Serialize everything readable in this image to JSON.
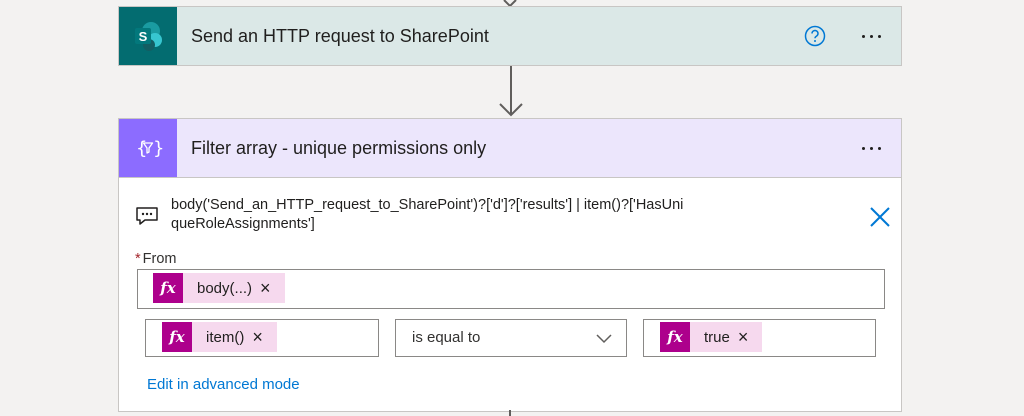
{
  "sharepoint_action": {
    "title": "Send an HTTP request to SharePoint",
    "icon": "sharepoint-logo-icon",
    "icon_letter": "S",
    "help_icon": "question-circle-icon",
    "more_icon": "more-dots-icon",
    "accent": "#036c70",
    "header_bg": "#dbe8e7"
  },
  "filter_action": {
    "title": "Filter array - unique permissions only",
    "icon": "filter-braces-icon",
    "icon_text": "{",
    "icon_text_right": "}",
    "more_icon": "more-dots-icon",
    "accent": "#8c6cff",
    "header_bg": "#ece6fc",
    "expression": {
      "icon": "comment-icon",
      "text": "body('Send_an_HTTP_request_to_SharePoint')?['d']?['results'] | item()?['HasUniqueRoleAssignments']",
      "close_icon": "close-icon"
    },
    "from": {
      "required_marker": "*",
      "label": "From",
      "token": {
        "fx": "fx",
        "label": "body(...)",
        "remove": "×"
      }
    },
    "condition": {
      "left_token": {
        "fx": "fx",
        "label": "item()",
        "remove": "×"
      },
      "operator": "is equal to",
      "operator_icon": "chevron-down-icon",
      "right_token": {
        "fx": "fx",
        "label": "true",
        "remove": "×"
      }
    },
    "advanced_link": "Edit in advanced mode"
  },
  "colors": {
    "expression_token": "#ad008c",
    "token_bg": "#f6d9ee",
    "link": "#0078d4"
  }
}
